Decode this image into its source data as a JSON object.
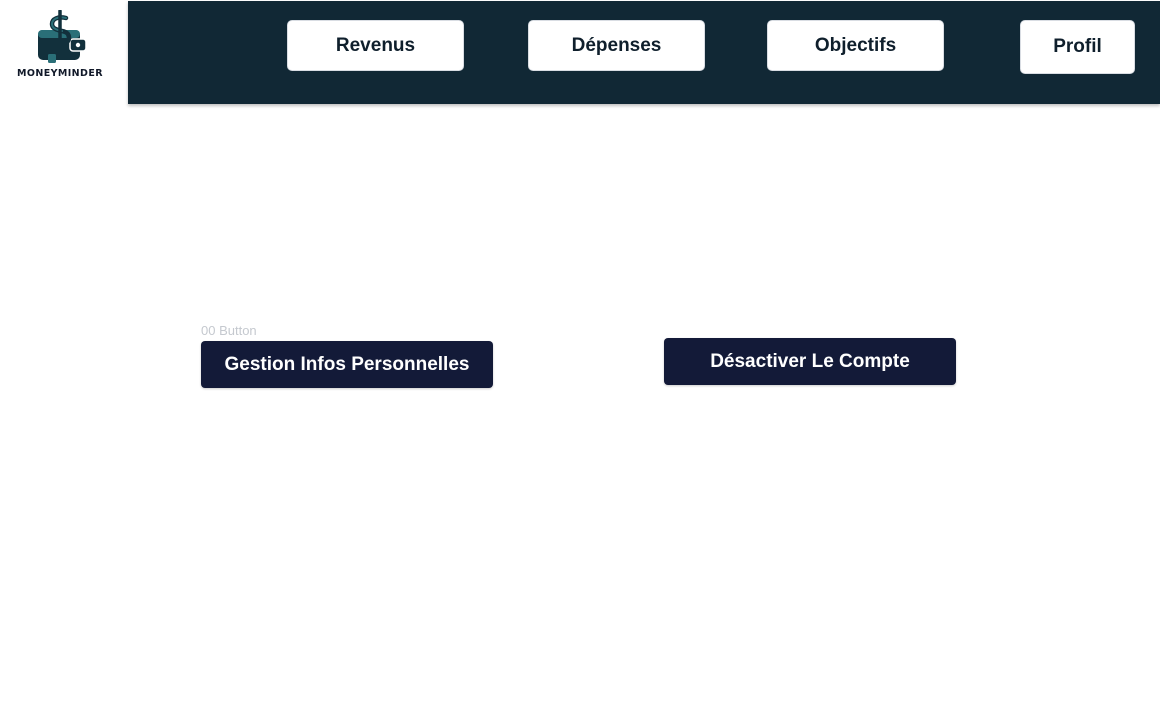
{
  "brand": {
    "name": "MONEYMINDER",
    "colors": {
      "navbar": "#112835",
      "action_button": "#131a38",
      "logo_teal": "#2a6f78",
      "logo_dark": "#12303c"
    },
    "icon": "wallet-dollar-icon"
  },
  "nav": {
    "items": [
      {
        "label": "Revenus"
      },
      {
        "label": "Dépenses"
      },
      {
        "label": "Objectifs"
      },
      {
        "label": "Profil"
      }
    ]
  },
  "main": {
    "component_label": "00 Button",
    "actions": [
      {
        "label": "Gestion Infos Personnelles"
      },
      {
        "label": "Désactiver Le Compte"
      }
    ]
  }
}
